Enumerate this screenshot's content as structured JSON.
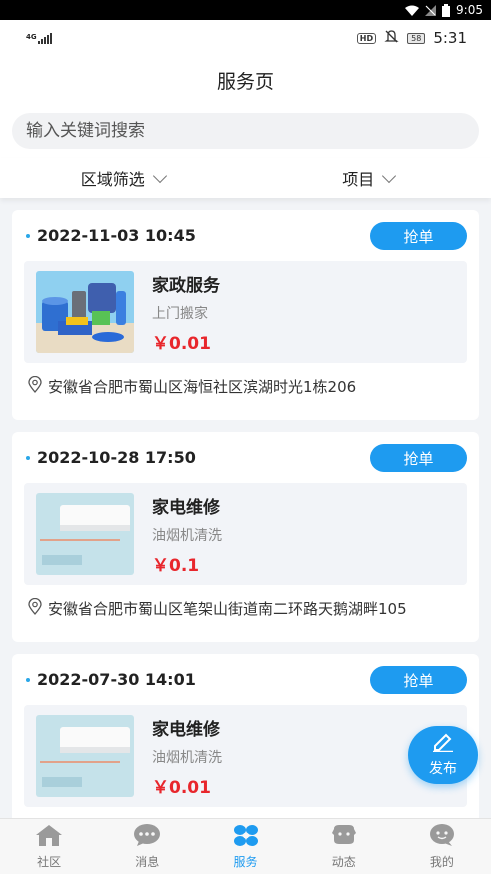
{
  "system_bar": {
    "time": "9:05"
  },
  "app_status": {
    "network": "4G",
    "badge": "HD",
    "battery": "58",
    "time": "5:31"
  },
  "header": {
    "title": "服务页"
  },
  "search": {
    "placeholder": "输入关键词搜索"
  },
  "filters": [
    {
      "label": "区域筛选"
    },
    {
      "label": "项目"
    }
  ],
  "orders": [
    {
      "datetime": "2022-11-03 10:45",
      "action": "抢单",
      "title": "家政服务",
      "subtitle": "上门搬家",
      "price": "￥0.01",
      "address": "安徽省合肥市蜀山区海恒社区滨湖时光1栋206",
      "thumb": "cleaning-products"
    },
    {
      "datetime": "2022-10-28 17:50",
      "action": "抢单",
      "title": "家电维修",
      "subtitle": "油烟机清洗",
      "price": "￥0.1",
      "address": "安徽省合肥市蜀山区笔架山街道南二环路天鹅湖畔105",
      "thumb": "air-conditioner"
    },
    {
      "datetime": "2022-07-30 14:01",
      "action": "抢单",
      "title": "家电维修",
      "subtitle": "油烟机清洗",
      "price": "￥0.01",
      "address": "",
      "thumb": "air-conditioner"
    }
  ],
  "fab": {
    "label": "发布"
  },
  "tabs": [
    {
      "label": "社区",
      "icon": "home-icon"
    },
    {
      "label": "消息",
      "icon": "chat-bubble-icon"
    },
    {
      "label": "服务",
      "icon": "grid-petals-icon",
      "active": true
    },
    {
      "label": "动态",
      "icon": "bubble-icon"
    },
    {
      "label": "我的",
      "icon": "person-bubble-icon"
    }
  ],
  "colors": {
    "accent": "#1e9bf0",
    "price": "#e8262c",
    "background": "#f2f4f7"
  }
}
